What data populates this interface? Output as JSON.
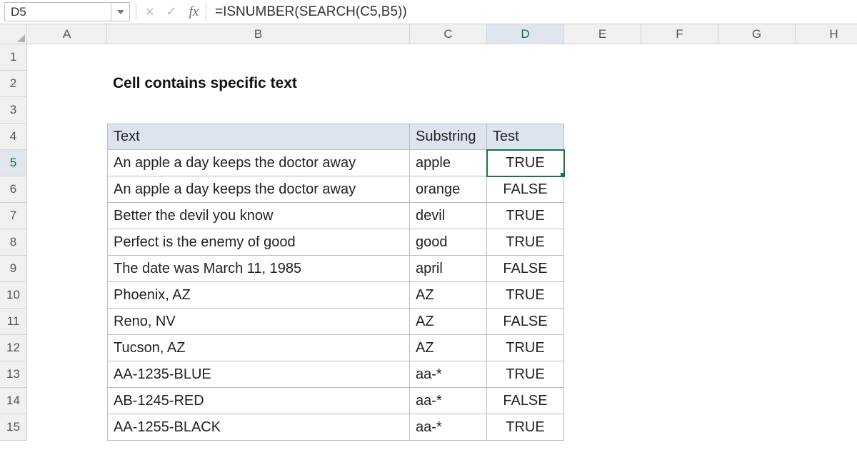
{
  "nameBox": "D5",
  "formula": "=ISNUMBER(SEARCH(C5,B5))",
  "columns": [
    "A",
    "B",
    "C",
    "D",
    "E",
    "F",
    "G",
    "H"
  ],
  "rows": [
    "1",
    "2",
    "3",
    "4",
    "5",
    "6",
    "7",
    "8",
    "9",
    "10",
    "11",
    "12",
    "13",
    "14",
    "15"
  ],
  "title": "Cell contains specific text",
  "selectedCol": "D",
  "selectedRow": "5",
  "table": {
    "headers": {
      "text": "Text",
      "substring": "Substring",
      "test": "Test"
    },
    "rows": [
      {
        "text": "An apple a day keeps the doctor away",
        "substring": "apple",
        "test": "TRUE"
      },
      {
        "text": "An apple a day keeps the doctor away",
        "substring": "orange",
        "test": "FALSE"
      },
      {
        "text": "Better the devil you know",
        "substring": "devil",
        "test": "TRUE"
      },
      {
        "text": "Perfect is the enemy of good",
        "substring": "good",
        "test": "TRUE"
      },
      {
        "text": "The date was March 11, 1985",
        "substring": "april",
        "test": "FALSE"
      },
      {
        "text": "Phoenix, AZ",
        "substring": "AZ",
        "test": "TRUE"
      },
      {
        "text": "Reno, NV",
        "substring": "AZ",
        "test": "FALSE"
      },
      {
        "text": "Tucson, AZ",
        "substring": "AZ",
        "test": "TRUE"
      },
      {
        "text": "AA-1235-BLUE",
        "substring": "aa-*",
        "test": "TRUE"
      },
      {
        "text": "AB-1245-RED",
        "substring": "aa-*",
        "test": "FALSE"
      },
      {
        "text": "AA-1255-BLACK",
        "substring": "aa-*",
        "test": "TRUE"
      }
    ]
  },
  "chart_data": {
    "type": "table",
    "title": "Cell contains specific text",
    "columns": [
      "Text",
      "Substring",
      "Test"
    ],
    "rows": [
      [
        "An apple a day keeps the doctor away",
        "apple",
        "TRUE"
      ],
      [
        "An apple a day keeps the doctor away",
        "orange",
        "FALSE"
      ],
      [
        "Better the devil you know",
        "devil",
        "TRUE"
      ],
      [
        "Perfect is the enemy of good",
        "good",
        "TRUE"
      ],
      [
        "The date was March 11, 1985",
        "april",
        "FALSE"
      ],
      [
        "Phoenix, AZ",
        "AZ",
        "TRUE"
      ],
      [
        "Reno, NV",
        "AZ",
        "FALSE"
      ],
      [
        "Tucson, AZ",
        "AZ",
        "TRUE"
      ],
      [
        "AA-1235-BLUE",
        "aa-*",
        "TRUE"
      ],
      [
        "AB-1245-RED",
        "aa-*",
        "FALSE"
      ],
      [
        "AA-1255-BLACK",
        "aa-*",
        "TRUE"
      ]
    ]
  }
}
